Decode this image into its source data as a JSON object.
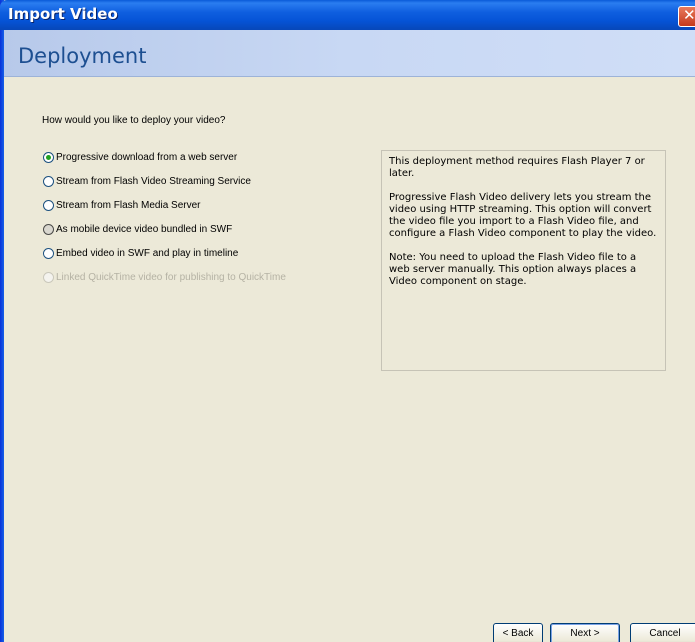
{
  "window": {
    "title": "Import Video",
    "close_glyph": "✕"
  },
  "header": {
    "title": "Deployment"
  },
  "deploy": {
    "question": "How would you like to deploy your video?",
    "options": [
      {
        "label": "Progressive download from a web server",
        "selected": true,
        "enabled": true
      },
      {
        "label": "Stream from Flash Video Streaming Service",
        "selected": false,
        "enabled": true
      },
      {
        "label": "Stream from Flash Media Server",
        "selected": false,
        "enabled": true
      },
      {
        "label": "As mobile device video bundled in SWF",
        "selected": false,
        "enabled": true
      },
      {
        "label": "Embed video in SWF and play in timeline",
        "selected": false,
        "enabled": true
      },
      {
        "label": "Linked QuickTime video for publishing to QuickTime",
        "selected": false,
        "enabled": false
      }
    ]
  },
  "info": {
    "paragraph_1": "This deployment method requires Flash Player 7 or later.",
    "paragraph_2": "Progressive Flash Video delivery lets you stream the video using HTTP streaming. This option will convert the video file you import to a Flash Video file, and configure a Flash Video component to play the video.",
    "paragraph_3": "Note: You need to upload the Flash Video file to a web server manually.  This option always places a Video component on stage."
  },
  "buttons": {
    "back": "< Back",
    "next": "Next >",
    "cancel": "Cancel"
  },
  "colors": {
    "titlebar": "#0553d6",
    "header_band": "#c8d8f4",
    "header_text": "#1d4f91",
    "dialog_bg": "#ece9d8",
    "radio_selected": "#21a121",
    "disabled_text": "#b5b2a4"
  }
}
